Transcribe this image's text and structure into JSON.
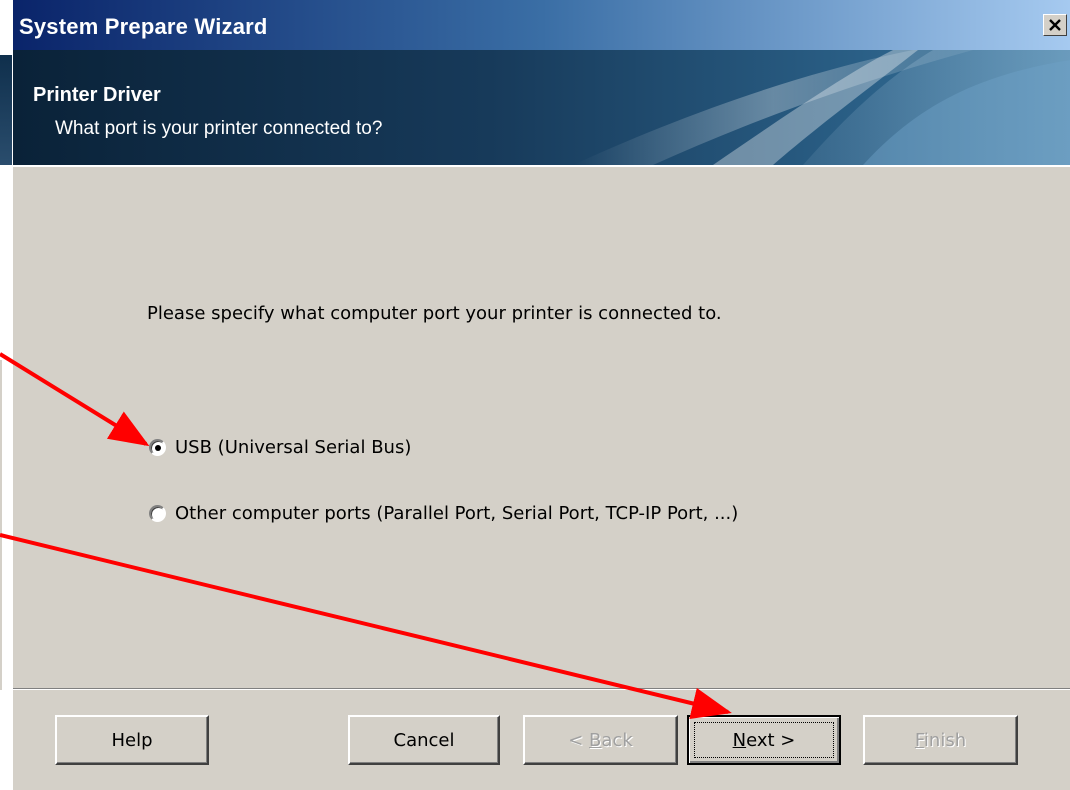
{
  "window": {
    "title": "System Prepare Wizard",
    "close_glyph": "✕"
  },
  "header": {
    "title": "Printer Driver",
    "subtitle": "What port is your printer connected to?"
  },
  "body": {
    "prompt": "Please specify what computer port your printer is connected to.",
    "options": [
      {
        "label": "USB (Universal Serial Bus)",
        "selected": true
      },
      {
        "label": "Other computer ports (Parallel Port, Serial Port, TCP-IP Port, ...)",
        "selected": false
      }
    ]
  },
  "buttons": {
    "help": {
      "label": "Help",
      "enabled": true
    },
    "cancel": {
      "label": "Cancel",
      "enabled": true
    },
    "back": {
      "prefix": "< ",
      "accel": "B",
      "rest": "ack",
      "enabled": false
    },
    "next": {
      "accel": "N",
      "rest": "ext >",
      "enabled": true,
      "default": true
    },
    "finish": {
      "accel": "F",
      "rest": "inish",
      "enabled": false
    }
  },
  "annotations": {
    "arrow_color": "#ff0000"
  }
}
